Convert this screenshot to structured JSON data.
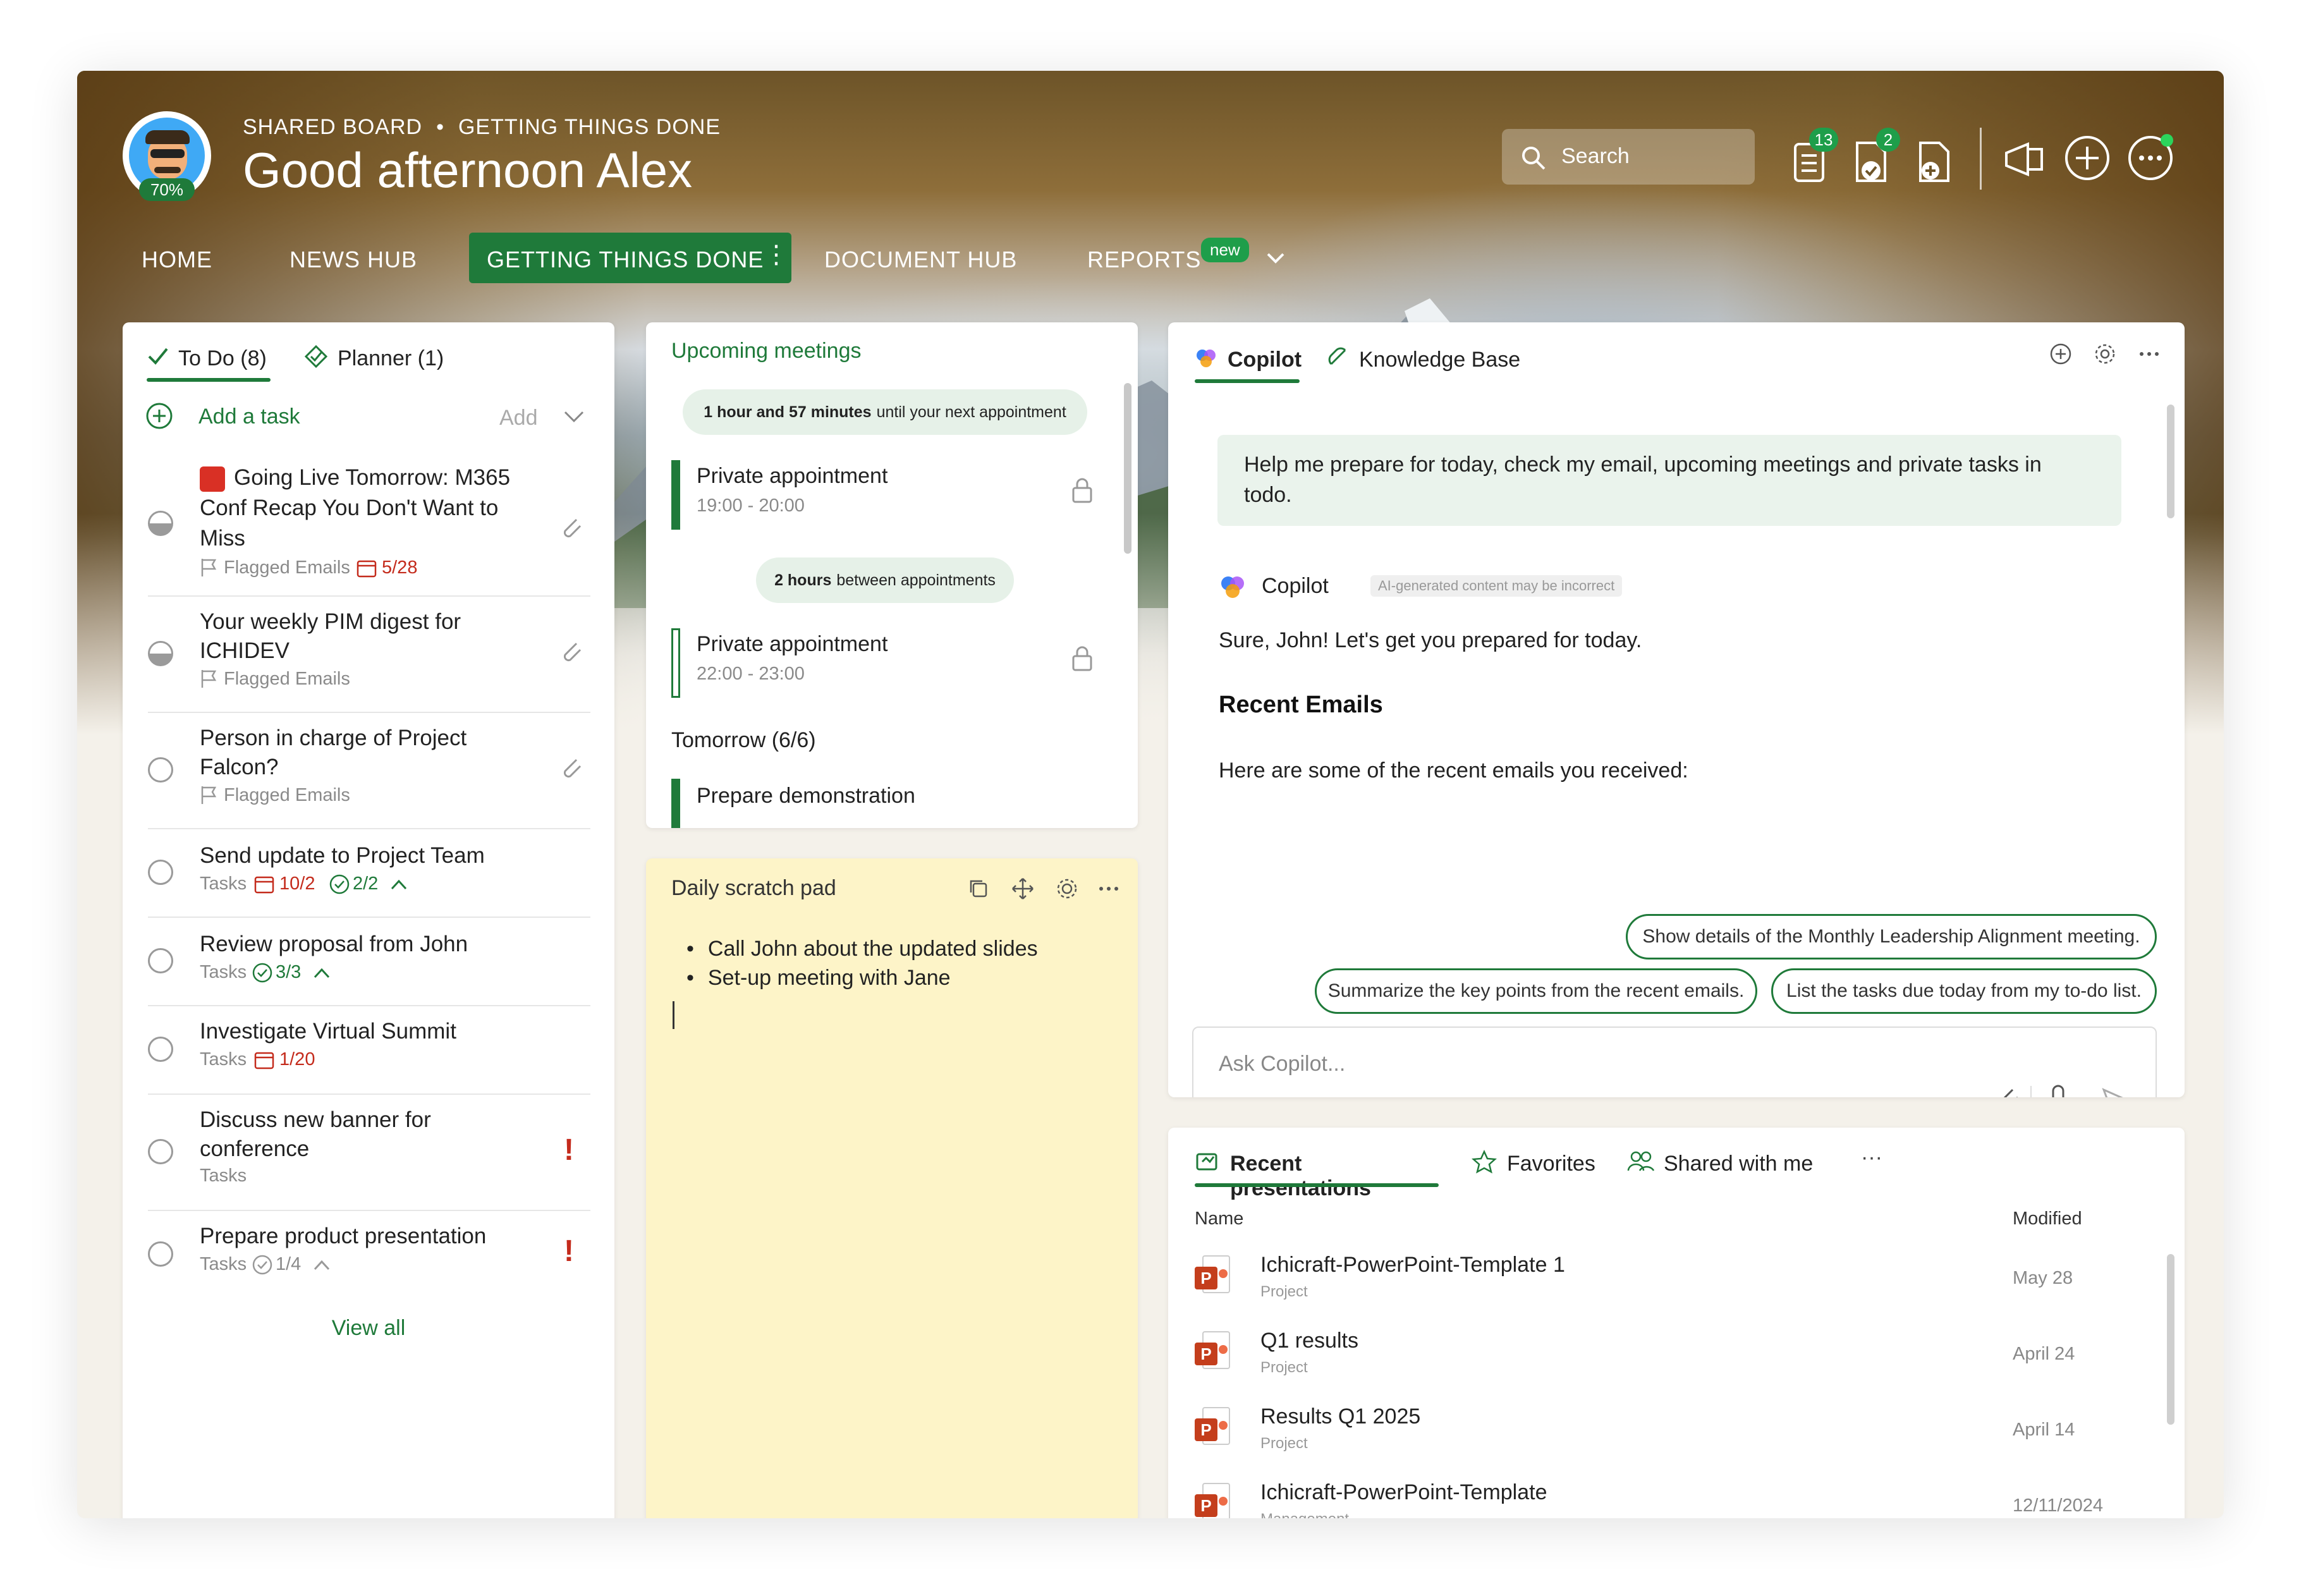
{
  "header": {
    "avatar_percent": "70%",
    "breadcrumb_1": "SHARED BOARD",
    "breadcrumb_sep": "•",
    "breadcrumb_2": "GETTING THINGS DONE",
    "greeting": "Good afternoon Alex",
    "search_placeholder": "Search",
    "badge_tasks": "13",
    "badge_approvals": "2"
  },
  "nav": {
    "home": "HOME",
    "news_hub": "NEWS HUB",
    "getting_things_done": "GETTING THINGS DONE",
    "document_hub": "DOCUMENT HUB",
    "reports": "REPORTS",
    "reports_badge": "new"
  },
  "todo": {
    "tab_todo": "To Do (8)",
    "tab_planner": "Planner (1)",
    "add_task": "Add a task",
    "add_label": "Add",
    "view_all": "View all",
    "items": [
      {
        "title_l1": "Going Live Tomorrow: M365",
        "title_l2": "Conf Recap You Don't Want to",
        "title_l3": "Miss",
        "source": "Flagged Emails",
        "date": "5/28"
      },
      {
        "title_l1": "Your weekly PIM digest for",
        "title_l2": "ICHIDEV",
        "source": "Flagged Emails"
      },
      {
        "title_l1": "Person in charge of Project",
        "title_l2": "Falcon?",
        "source": "Flagged Emails"
      },
      {
        "title_l1": "Send update to Project Team",
        "source": "Tasks",
        "date": "10/2",
        "check": "2/2"
      },
      {
        "title_l1": "Review proposal from John",
        "source": "Tasks",
        "check": "3/3"
      },
      {
        "title_l1": "Investigate Virtual Summit",
        "source": "Tasks",
        "date": "1/20"
      },
      {
        "title_l1": "Discuss new banner for",
        "title_l2": "conference",
        "source": "Tasks"
      },
      {
        "title_l1": "Prepare product presentation",
        "source": "Tasks",
        "check": "1/4"
      }
    ]
  },
  "meetings": {
    "title": "Upcoming meetings",
    "next_bold": "1 hour and 57 minutes",
    "next_rest": "until your next appointment",
    "gap_bold": "2 hours",
    "gap_rest": "between appointments",
    "appt1_title": "Private appointment",
    "appt1_time": "19:00 - 20:00",
    "appt2_title": "Private appointment",
    "appt2_time": "22:00 - 23:00",
    "tomorrow": "Tomorrow (6/6)",
    "appt3_title": "Prepare demonstration"
  },
  "scratch": {
    "title": "Daily scratch pad",
    "bullets": [
      "Call John about the updated slides",
      "Set-up meeting with Jane"
    ]
  },
  "copilot": {
    "tab_copilot": "Copilot",
    "tab_kb": "Knowledge Base",
    "user_msg_l1": "Help me prepare for today, check my email, upcoming meetings and private tasks in",
    "user_msg_l2": "todo.",
    "bot_name": "Copilot",
    "disclaimer": "AI-generated content may be incorrect",
    "reply": "Sure, John! Let's get you prepared for today.",
    "heading": "Recent Emails",
    "intro": "Here are some of the recent emails you received:",
    "suggestion_1": "Show details of the Monthly Leadership Alignment meeting.",
    "suggestion_2": "Summarize the key points from the recent emails.",
    "suggestion_3": "List the tasks due today from my to-do list.",
    "input_placeholder": "Ask Copilot..."
  },
  "presentations": {
    "tab_recent": "Recent presentations",
    "tab_favorites": "Favorites",
    "tab_shared": "Shared with me",
    "more": "···",
    "col_name": "Name",
    "col_modified": "Modified",
    "rows": [
      {
        "name": "Ichicraft-PowerPoint-Template 1",
        "location": "Project",
        "modified": "May 28"
      },
      {
        "name": "Q1 results",
        "location": "Project",
        "modified": "April 24"
      },
      {
        "name": "Results Q1 2025",
        "location": "Project",
        "modified": "April 14"
      },
      {
        "name": "Ichicraft-PowerPoint-Template",
        "location": "Management",
        "modified": "12/11/2024"
      }
    ]
  },
  "colors": {
    "accent": "#1f7a3a",
    "scratch_bg": "#fdf4c8",
    "flag_red": "#c42b1c"
  }
}
